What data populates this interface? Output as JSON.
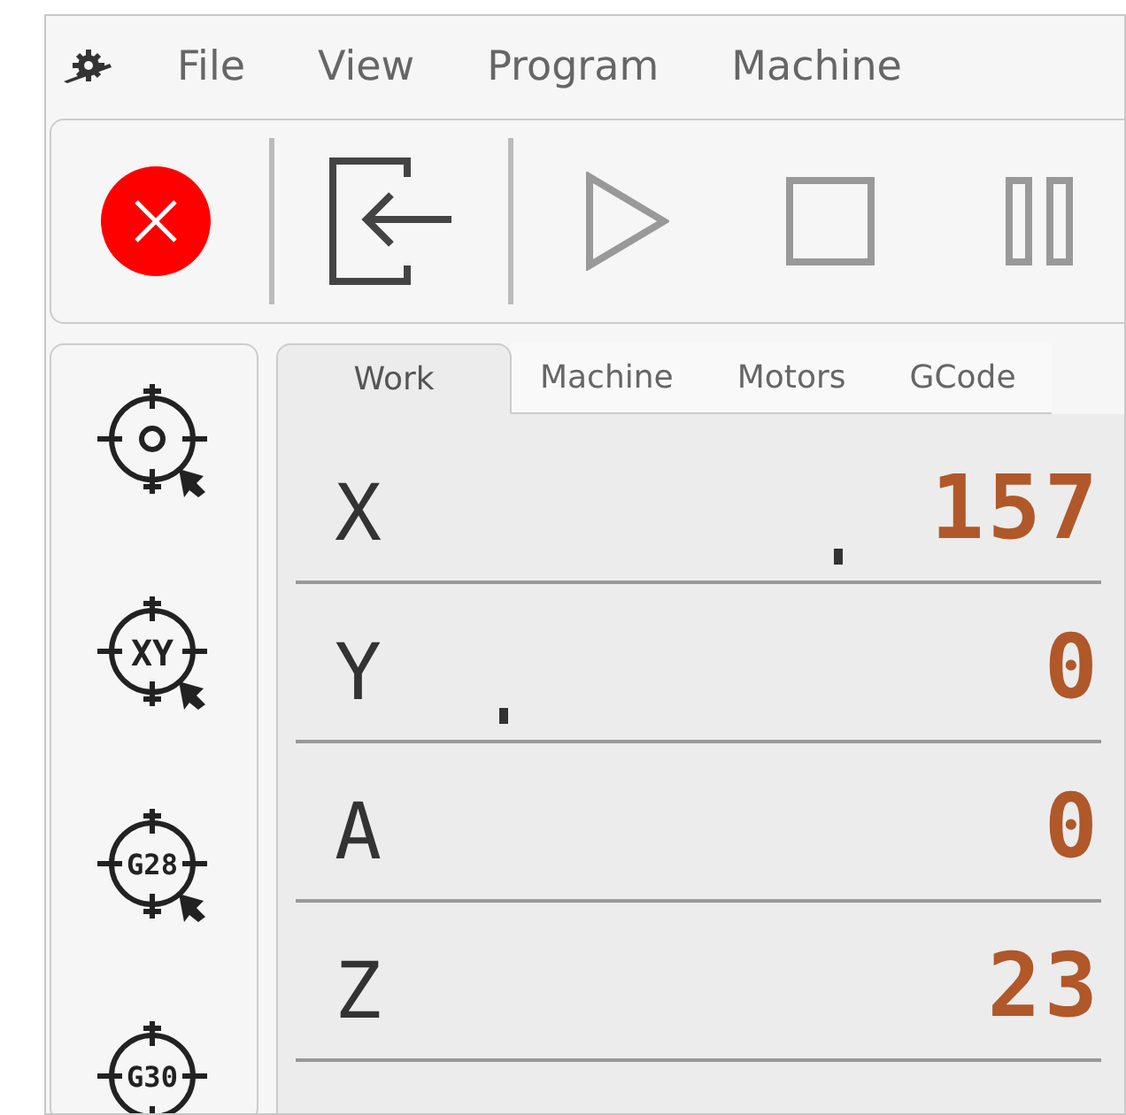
{
  "menu": [
    "File",
    "View",
    "Program",
    "Machine"
  ],
  "toolbar": [
    {
      "kind": "estop",
      "disabled": false
    },
    {
      "kind": "exit",
      "disabled": false
    },
    {
      "kind": "play",
      "disabled": true
    },
    {
      "kind": "stop",
      "disabled": true
    },
    {
      "kind": "pause",
      "disabled": true
    }
  ],
  "sidebar": [
    {
      "kind": "origin"
    },
    {
      "kind": "label",
      "label": "XY"
    },
    {
      "kind": "label",
      "label": "G28"
    },
    {
      "kind": "label",
      "label": "G30"
    }
  ],
  "tabs": [
    {
      "label": "Work",
      "selected": true
    },
    {
      "label": "Machine",
      "selected": false
    },
    {
      "label": "Motors",
      "selected": false
    },
    {
      "label": "GCode",
      "selected": false
    }
  ],
  "axes": [
    {
      "axis": "X",
      "value": "157",
      "marker": true
    },
    {
      "axis": "Y",
      "value": "0",
      "marker": true
    },
    {
      "axis": "A",
      "value": "0",
      "marker": false
    },
    {
      "axis": "Z",
      "value": "23",
      "marker": false
    }
  ]
}
